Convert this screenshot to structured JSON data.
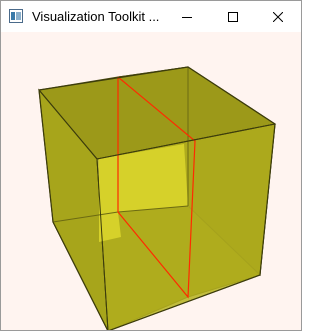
{
  "window": {
    "title": "Visualization Toolkit ...",
    "icon": "vtk-app-icon",
    "controls": {
      "minimize_icon": "minimize-icon",
      "maximize_icon": "maximize-icon",
      "close_icon": "close-icon"
    }
  },
  "scene": {
    "background_color": "#fff4f0",
    "cube_color": "#c8c41a",
    "edge_color": "#4a4a10",
    "cut_plane_color": "#ff2a00"
  }
}
